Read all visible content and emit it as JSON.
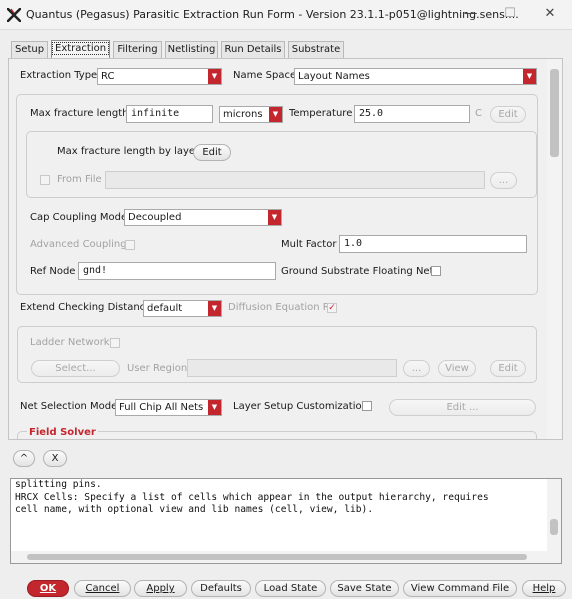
{
  "window": {
    "title": "Quantus (Pegasus) Parasitic Extraction Run Form - Version 23.1.1-p051@lightning.sens....",
    "minimize": "—",
    "maximize": "☐",
    "close": "✕"
  },
  "tabs": [
    "Setup",
    "Extraction",
    "Filtering",
    "Netlisting",
    "Run Details",
    "Substrate"
  ],
  "active_tab": "Extraction",
  "extraction": {
    "extraction_type_label": "Extraction Type",
    "extraction_type_value": "RC",
    "name_space_label": "Name Space",
    "name_space_value": "Layout Names",
    "max_fracture_label": "Max fracture length",
    "max_fracture_value": "infinite",
    "units_value": "microns",
    "temperature_label": "Temperature",
    "temperature_value": "25.0",
    "temperature_unit": "C",
    "edit_label": "Edit",
    "by_layer_label": "Max fracture length by layer",
    "from_file_label": "From File",
    "browse_label": "...",
    "cap_coupling_label": "Cap Coupling Mode",
    "cap_coupling_value": "Decoupled",
    "advanced_coupling_label": "Advanced Coupling",
    "mult_factor_label": "Mult Factor",
    "mult_factor_value": "1.0",
    "ref_node_label": "Ref Node",
    "ref_node_value": "gnd!",
    "ground_substrate_label": "Ground Substrate Floating Nets",
    "extend_checking_label": "Extend Checking Distance",
    "extend_checking_value": "default",
    "diffusion_label": "Diffusion Equation R",
    "diffusion_check": "✓",
    "ladder_network_label": "Ladder Network",
    "select_label": "Select...",
    "user_region_label": "User Region",
    "view_label": "View",
    "net_selection_label": "Net Selection Mode",
    "net_selection_value": "Full Chip All Nets",
    "layer_setup_label": "Layer Setup Customization",
    "edit_ellipsis_label": "Edit ...",
    "field_solver_label": "Field Solver"
  },
  "arrows": {
    "up": "^",
    "close": "X"
  },
  "console": {
    "lines": [
      "splitting pins.",
      "",
      "HRCX Cells: Specify a list of cells which appear in the output hierarchy, requires",
      "cell name, with optional view and lib names (cell, view, lib)."
    ]
  },
  "buttons": [
    "OK",
    "Cancel",
    "Apply",
    "Defaults",
    "Load State",
    "Save State",
    "View Command File",
    "Help"
  ],
  "colors": {
    "accent": "#c4262e"
  }
}
